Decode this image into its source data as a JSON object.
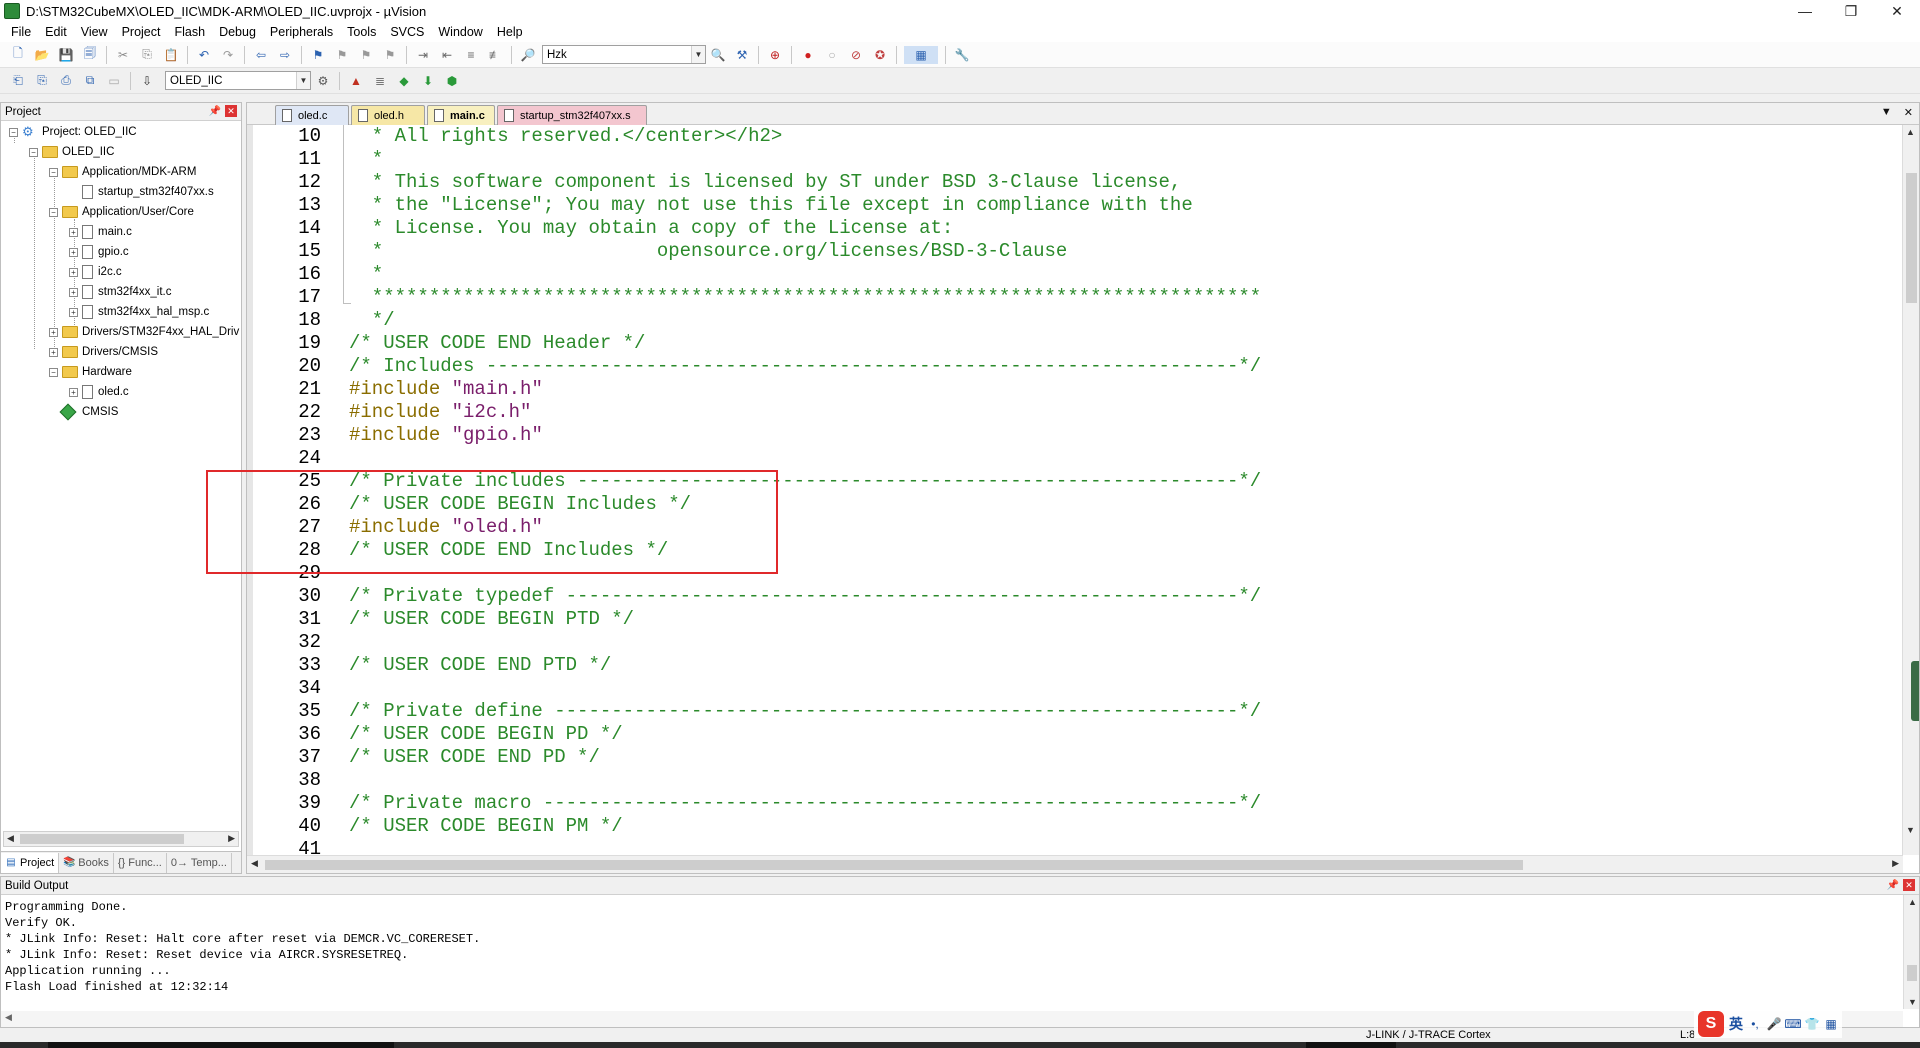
{
  "window": {
    "title": "D:\\STM32CubeMX\\OLED_IIC\\MDK-ARM\\OLED_IIC.uvprojx - µVision",
    "controls": [
      "—",
      "❐",
      "✕"
    ]
  },
  "menu": [
    "File",
    "Edit",
    "View",
    "Project",
    "Flash",
    "Debug",
    "Peripherals",
    "Tools",
    "SVCS",
    "Window",
    "Help"
  ],
  "toolbar": {
    "find_combo": "Hzk",
    "target_combo": "OLED_IIC"
  },
  "project_panel": {
    "title": "Project",
    "tree": [
      {
        "label": "Project: OLED_IIC",
        "icon": "project-icon"
      },
      {
        "label": "OLED_IIC",
        "icon": "folder-icon"
      },
      {
        "label": "Application/MDK-ARM",
        "icon": "folder-icon"
      },
      {
        "label": "startup_stm32f407xx.s",
        "icon": "file-icon"
      },
      {
        "label": "Application/User/Core",
        "icon": "folder-icon"
      },
      {
        "label": "main.c",
        "icon": "file-icon"
      },
      {
        "label": "gpio.c",
        "icon": "file-icon"
      },
      {
        "label": "i2c.c",
        "icon": "file-icon"
      },
      {
        "label": "stm32f4xx_it.c",
        "icon": "file-icon"
      },
      {
        "label": "stm32f4xx_hal_msp.c",
        "icon": "file-icon"
      },
      {
        "label": "Drivers/STM32F4xx_HAL_Driv",
        "icon": "folder-icon"
      },
      {
        "label": "Drivers/CMSIS",
        "icon": "folder-icon"
      },
      {
        "label": "Hardware",
        "icon": "folder-icon"
      },
      {
        "label": "oled.c",
        "icon": "file-icon"
      },
      {
        "label": "CMSIS",
        "icon": "diamond-icon"
      }
    ],
    "tabs": [
      "Project",
      "Books",
      "{} Func...",
      "0→ Temp..."
    ]
  },
  "editor": {
    "tabs": [
      "oled.c",
      "oled.h",
      "main.c",
      "startup_stm32f407xx.s"
    ],
    "active_tab": "main.c",
    "lines": [
      {
        "n": "10",
        "parts": [
          {
            "t": "  * All rights reserved.</center></h2>",
            "c": "comment"
          }
        ]
      },
      {
        "n": "11",
        "parts": [
          {
            "t": "  *",
            "c": "comment"
          }
        ]
      },
      {
        "n": "12",
        "parts": [
          {
            "t": "  * This software component is licensed by ST under BSD 3-Clause license,",
            "c": "comment"
          }
        ]
      },
      {
        "n": "13",
        "parts": [
          {
            "t": "  * the \"License\"; You may not use this file except in compliance with the",
            "c": "comment"
          }
        ]
      },
      {
        "n": "14",
        "parts": [
          {
            "t": "  * License. You may obtain a copy of the License at:",
            "c": "comment"
          }
        ]
      },
      {
        "n": "15",
        "parts": [
          {
            "t": "  *                        opensource.org/licenses/BSD-3-Clause",
            "c": "comment"
          }
        ]
      },
      {
        "n": "16",
        "parts": [
          {
            "t": "  *",
            "c": "comment"
          }
        ]
      },
      {
        "n": "17",
        "parts": [
          {
            "t": "  ******************************************************************************",
            "c": "comment"
          }
        ]
      },
      {
        "n": "18",
        "parts": [
          {
            "t": "  */",
            "c": "comment"
          }
        ]
      },
      {
        "n": "19",
        "parts": [
          {
            "t": "/* USER CODE END Header */",
            "c": "comment"
          }
        ]
      },
      {
        "n": "20",
        "parts": [
          {
            "t": "/* Includes ------------------------------------------------------------------*/",
            "c": "comment"
          }
        ]
      },
      {
        "n": "21",
        "parts": [
          {
            "t": "#include ",
            "c": "pp"
          },
          {
            "t": "\"main.h\"",
            "c": "str"
          }
        ]
      },
      {
        "n": "22",
        "parts": [
          {
            "t": "#include ",
            "c": "pp"
          },
          {
            "t": "\"i2c.h\"",
            "c": "str"
          }
        ]
      },
      {
        "n": "23",
        "parts": [
          {
            "t": "#include ",
            "c": "pp"
          },
          {
            "t": "\"gpio.h\"",
            "c": "str"
          }
        ]
      },
      {
        "n": "24",
        "parts": []
      },
      {
        "n": "25",
        "parts": [
          {
            "t": "/* Private includes ----------------------------------------------------------*/",
            "c": "comment"
          }
        ]
      },
      {
        "n": "26",
        "parts": [
          {
            "t": "/* USER CODE BEGIN Includes */",
            "c": "comment"
          }
        ]
      },
      {
        "n": "27",
        "parts": [
          {
            "t": "#include ",
            "c": "pp"
          },
          {
            "t": "\"oled.h\"",
            "c": "str"
          }
        ]
      },
      {
        "n": "28",
        "parts": [
          {
            "t": "/* USER CODE END Includes */",
            "c": "comment"
          }
        ]
      },
      {
        "n": "29",
        "parts": []
      },
      {
        "n": "30",
        "parts": [
          {
            "t": "/* Private typedef -----------------------------------------------------------*/",
            "c": "comment"
          }
        ]
      },
      {
        "n": "31",
        "parts": [
          {
            "t": "/* USER CODE BEGIN PTD */",
            "c": "comment"
          }
        ]
      },
      {
        "n": "32",
        "parts": []
      },
      {
        "n": "33",
        "parts": [
          {
            "t": "/* USER CODE END PTD */",
            "c": "comment"
          }
        ]
      },
      {
        "n": "34",
        "parts": []
      },
      {
        "n": "35",
        "parts": [
          {
            "t": "/* Private define ------------------------------------------------------------*/",
            "c": "comment"
          }
        ]
      },
      {
        "n": "36",
        "parts": [
          {
            "t": "/* USER CODE BEGIN PD */",
            "c": "comment"
          }
        ]
      },
      {
        "n": "37",
        "parts": [
          {
            "t": "/* USER CODE END PD */",
            "c": "comment"
          }
        ]
      },
      {
        "n": "38",
        "parts": []
      },
      {
        "n": "39",
        "parts": [
          {
            "t": "/* Private macro -------------------------------------------------------------*/",
            "c": "comment"
          }
        ]
      },
      {
        "n": "40",
        "parts": [
          {
            "t": "/* USER CODE BEGIN PM */",
            "c": "comment"
          }
        ]
      },
      {
        "n": "41",
        "parts": []
      }
    ]
  },
  "build_output": {
    "title": "Build Output",
    "lines": [
      "Programming Done.",
      "Verify OK.",
      "* JLink Info: Reset: Halt core after reset via DEMCR.VC_CORERESET.",
      "* JLink Info: Reset: Reset device via AIRCR.SYSRESETREQ.",
      "Application running ...",
      "Flash Load finished at 12:32:14"
    ]
  },
  "status": {
    "debugger": "J-LINK / J-TRACE Cortex",
    "position": "L:8",
    "ime": "英"
  },
  "colors": {
    "comment": "#2b8a2b",
    "preprocessor": "#8a6d00",
    "string": "#7a1e6b",
    "highlight_box": "#e0292b"
  }
}
